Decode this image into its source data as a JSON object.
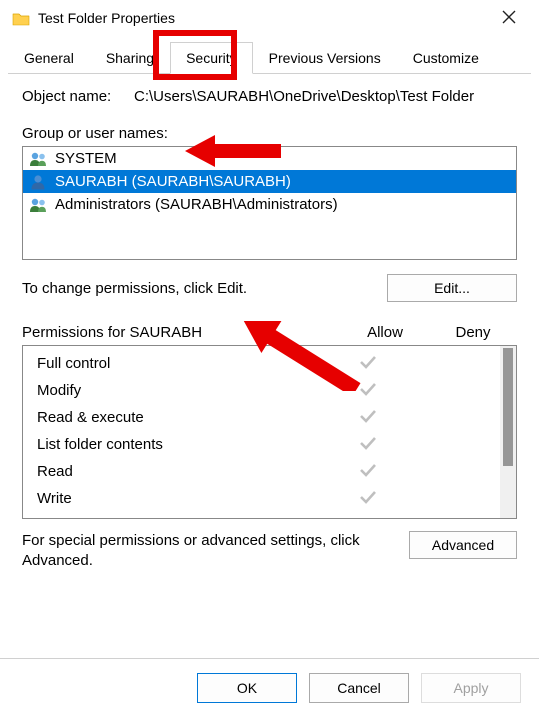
{
  "window": {
    "title": "Test Folder Properties"
  },
  "tabs": {
    "general": "General",
    "sharing": "Sharing",
    "security": "Security",
    "previous": "Previous Versions",
    "customize": "Customize"
  },
  "object": {
    "label": "Object name:",
    "path": "C:\\Users\\SAURABH\\OneDrive\\Desktop\\Test Folder"
  },
  "groups": {
    "label": "Group or user names:",
    "items": [
      {
        "name": "SYSTEM",
        "type": "group",
        "selected": false
      },
      {
        "name": "SAURABH (SAURABH\\SAURABH)",
        "type": "user",
        "selected": true
      },
      {
        "name": "Administrators (SAURABH\\Administrators)",
        "type": "group",
        "selected": false
      }
    ]
  },
  "edit": {
    "text": "To change permissions, click Edit.",
    "button": "Edit..."
  },
  "permissions": {
    "header": "Permissions for SAURABH",
    "allow": "Allow",
    "deny": "Deny",
    "rows": [
      {
        "name": "Full control",
        "allow": true,
        "deny": false
      },
      {
        "name": "Modify",
        "allow": true,
        "deny": false
      },
      {
        "name": "Read & execute",
        "allow": true,
        "deny": false
      },
      {
        "name": "List folder contents",
        "allow": true,
        "deny": false
      },
      {
        "name": "Read",
        "allow": true,
        "deny": false
      },
      {
        "name": "Write",
        "allow": true,
        "deny": false
      }
    ]
  },
  "special": {
    "text": "For special permissions or advanced settings, click Advanced.",
    "button": "Advanced"
  },
  "buttons": {
    "ok": "OK",
    "cancel": "Cancel",
    "apply": "Apply"
  }
}
